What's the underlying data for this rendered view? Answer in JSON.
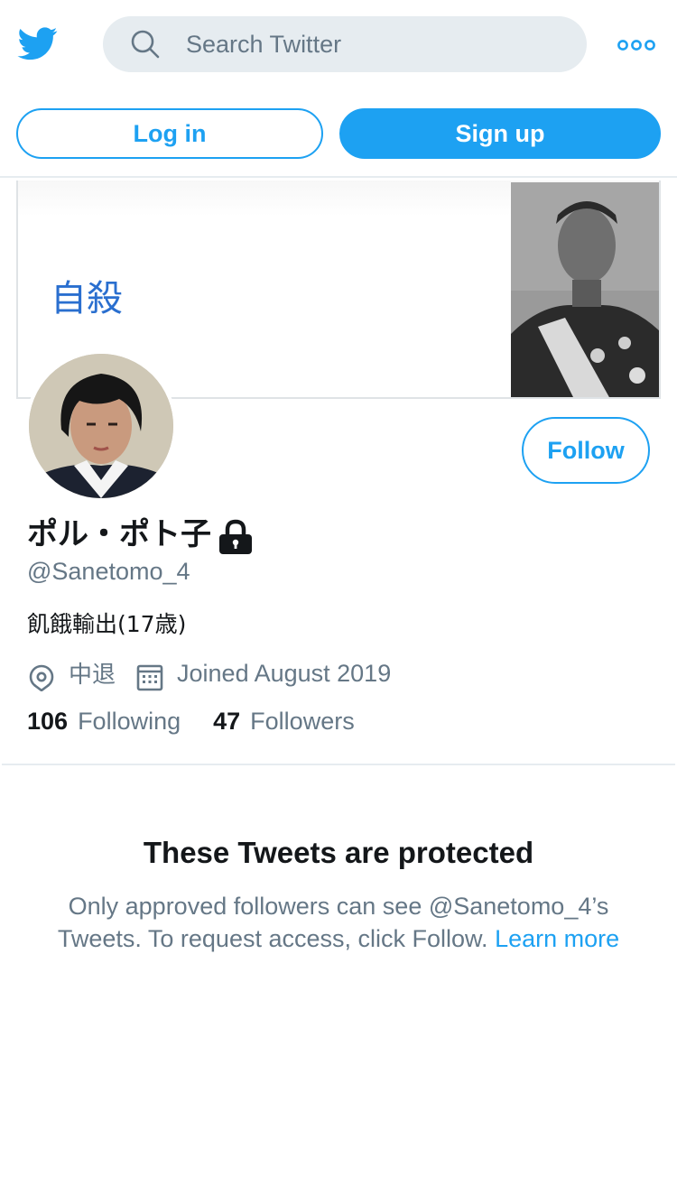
{
  "header": {
    "logo_icon": "twitter-bird-icon",
    "search": {
      "placeholder": "Search Twitter",
      "icon": "search-icon"
    },
    "more_icon": "more-options-icon"
  },
  "auth": {
    "login_label": "Log in",
    "signup_label": "Sign up"
  },
  "banner": {
    "text": "自殺"
  },
  "profile": {
    "display_name": "ポル・ポト子",
    "protected_icon": "lock-icon",
    "handle": "@Sanetomo_4",
    "bio": "飢餓輸出(17歳)",
    "location": "中退",
    "joined": "Joined August 2019",
    "follow_label": "Follow",
    "stats": {
      "following_count": "106",
      "following_label": "Following",
      "followers_count": "47",
      "followers_label": "Followers"
    }
  },
  "protected_notice": {
    "title": "These Tweets are protected",
    "message": "Only approved followers can see @Sanetomo_4’s Tweets. To request access, click Follow.",
    "learn_more": "Learn more"
  },
  "colors": {
    "brand_blue": "#1da1f2",
    "secondary_text": "#657786",
    "search_bg": "#e6ecf0",
    "banner_text": "#2a6fcf"
  }
}
